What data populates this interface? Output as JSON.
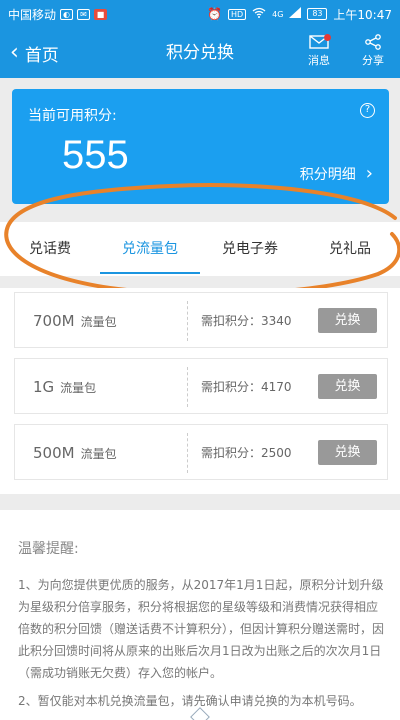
{
  "status_bar": {
    "carrier": "中国移动",
    "battery": "83",
    "time": "上午10:47",
    "signal_label": "4G",
    "hd_label": "HD"
  },
  "nav": {
    "back_label": "首页",
    "title": "积分兑换",
    "message_label": "消息",
    "share_label": "分享"
  },
  "points": {
    "label": "当前可用积分:",
    "value": "555",
    "detail_label": "积分明细"
  },
  "tabs": [
    {
      "label": "兑话费",
      "active": false
    },
    {
      "label": "兑流量包",
      "active": true
    },
    {
      "label": "兑电子券",
      "active": false
    },
    {
      "label": "兑礼品",
      "active": false
    }
  ],
  "products": [
    {
      "name": "700M",
      "unit": "流量包",
      "cost": "需扣积分：3340",
      "button": "兑换"
    },
    {
      "name": "1G",
      "unit": "流量包",
      "cost": "需扣积分：4170",
      "button": "兑换"
    },
    {
      "name": "500M",
      "unit": "流量包",
      "cost": "需扣积分：2500",
      "button": "兑换"
    }
  ],
  "notes": {
    "title": "温馨提醒:",
    "items": [
      "1、为向您提供更优质的服务，从2017年1月1日起，原积分计划升级为星级积分倍享服务，积分将根据您的星级等级和消费情况获得相应倍数的积分回馈（赠送话费不计算积分），但因计算积分赠送需时，因此积分回馈时间将从原来的出账后次月1日改为出账之后的次次月1日（需成功销账无欠费）存入您的帐户。",
      "2、暂仅能对本机兑换流量包，请先确认申请兑换的为本机号码。"
    ]
  },
  "colors": {
    "primary": "#1b95e0",
    "card": "#1b9ff0",
    "annotation": "#e8822a",
    "button_disabled": "#999999"
  }
}
